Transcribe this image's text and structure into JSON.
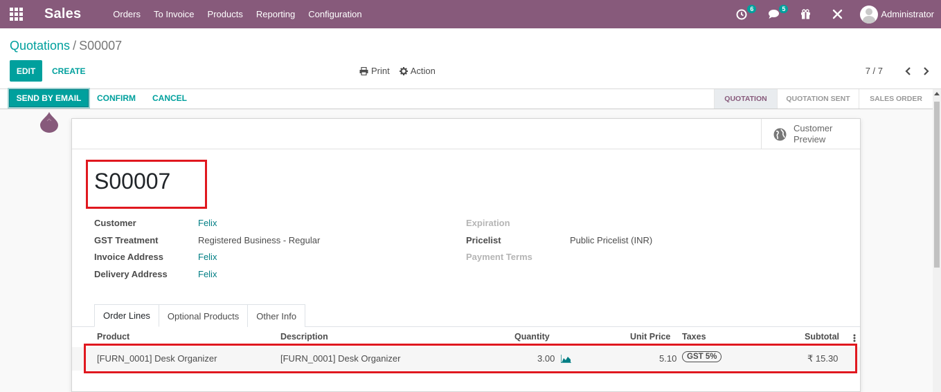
{
  "navbar": {
    "brand": "Sales",
    "menu": [
      "Orders",
      "To Invoice",
      "Products",
      "Reporting",
      "Configuration"
    ],
    "activity_count": "6",
    "messages_count": "5",
    "user": "Administrator",
    "color": "#875a7b"
  },
  "breadcrumb": {
    "parent": "Quotations",
    "separator": "/",
    "current": "S00007"
  },
  "buttons": {
    "edit": "EDIT",
    "create": "CREATE",
    "print": "Print",
    "action": "Action"
  },
  "pager": {
    "value": "7 / 7"
  },
  "statusbar": {
    "send_by_email": "SEND BY EMAIL",
    "confirm": "CONFIRM",
    "cancel": "CANCEL",
    "stages": [
      "QUOTATION",
      "QUOTATION SENT",
      "SALES ORDER"
    ],
    "active_stage": "QUOTATION"
  },
  "preview": {
    "label": "Customer Preview"
  },
  "order": {
    "name": "S00007",
    "fields": {
      "customer_label": "Customer",
      "customer": "Felix",
      "gst_label": "GST Treatment",
      "gst": "Registered Business - Regular",
      "invoice_label": "Invoice Address",
      "invoice": "Felix",
      "delivery_label": "Delivery Address",
      "delivery": "Felix",
      "expiration_label": "Expiration",
      "pricelist_label": "Pricelist",
      "pricelist": "Public Pricelist (INR)",
      "payment_terms_label": "Payment Terms"
    }
  },
  "tabs": [
    "Order Lines",
    "Optional Products",
    "Other Info"
  ],
  "table": {
    "headers": {
      "product": "Product",
      "description": "Description",
      "quantity": "Quantity",
      "unit_price": "Unit Price",
      "taxes": "Taxes",
      "subtotal": "Subtotal"
    },
    "rows": [
      {
        "product": "[FURN_0001] Desk Organizer",
        "description": "[FURN_0001] Desk Organizer",
        "quantity": "3.00",
        "unit_price": "5.10",
        "tax": "GST 5%",
        "subtotal": "₹ 15.30"
      }
    ]
  },
  "colors": {
    "accent": "#00a09d",
    "highlight": "#e0181f"
  }
}
